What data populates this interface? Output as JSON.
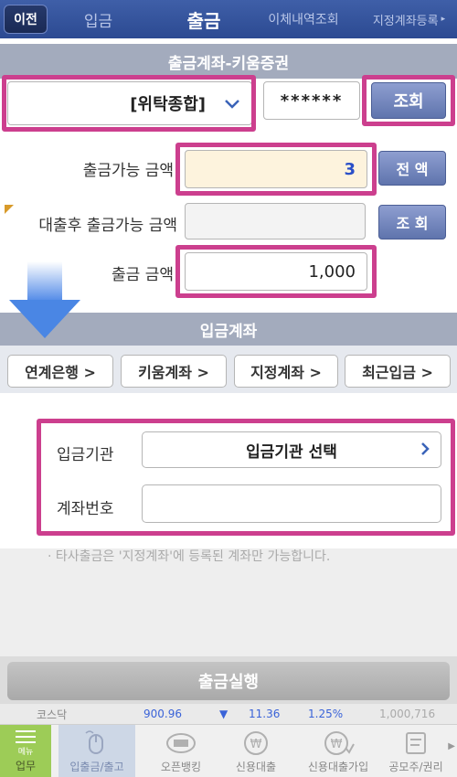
{
  "topnav": {
    "back": "이전",
    "tabs": [
      {
        "label": "입금"
      },
      {
        "label": "출금"
      },
      {
        "label": "이체내역조회"
      },
      {
        "label": "지정계좌등록"
      }
    ],
    "more_arrow": "▸"
  },
  "withdraw_account": {
    "header": "출금계좌-키움증권",
    "account_type": "[위탁종합]",
    "password_mask": "******",
    "inquiry_button": "조회"
  },
  "amounts": {
    "available_label": "출금가능 금액",
    "available_value": "3",
    "all_button": "전 액",
    "after_loan_label": "대출후 출금가능 금액",
    "after_loan_value": "",
    "after_loan_button": "조 회",
    "withdraw_label": "출금 금액",
    "withdraw_value": "1,000"
  },
  "deposit_account": {
    "header": "입금계좌",
    "tabs": [
      {
        "label": "연계은행 >"
      },
      {
        "label": "키움계좌 >"
      },
      {
        "label": "지정계좌 >"
      },
      {
        "label": "최근입금 >"
      }
    ],
    "institution_label": "입금기관",
    "institution_select": "입금기관 선택",
    "account_no_label": "계좌번호",
    "account_no_value": ""
  },
  "notice": "· 타사출금은 '지정계좌'에 등록된 계좌만 가능합니다.",
  "execute_button": "출금실행",
  "ticker": {
    "name": "코스닥",
    "index": "900.96",
    "arrow": "▼",
    "change": "11.36",
    "percent": "1.25%",
    "volume": "1,000,716"
  },
  "bottom_nav": {
    "menu_sub": "메뉴",
    "menu_main": "업무",
    "items": [
      {
        "label": "입출금/출고"
      },
      {
        "label": "오픈뱅킹"
      },
      {
        "label": "신용대출"
      },
      {
        "label": "신용대출가입"
      },
      {
        "label": "공모주/권리"
      }
    ],
    "more_arrow": "▶"
  },
  "colors": {
    "nav_blue": "#2c4a92",
    "highlight": "#cc3f8e",
    "ticker_down": "#3a63d8"
  }
}
